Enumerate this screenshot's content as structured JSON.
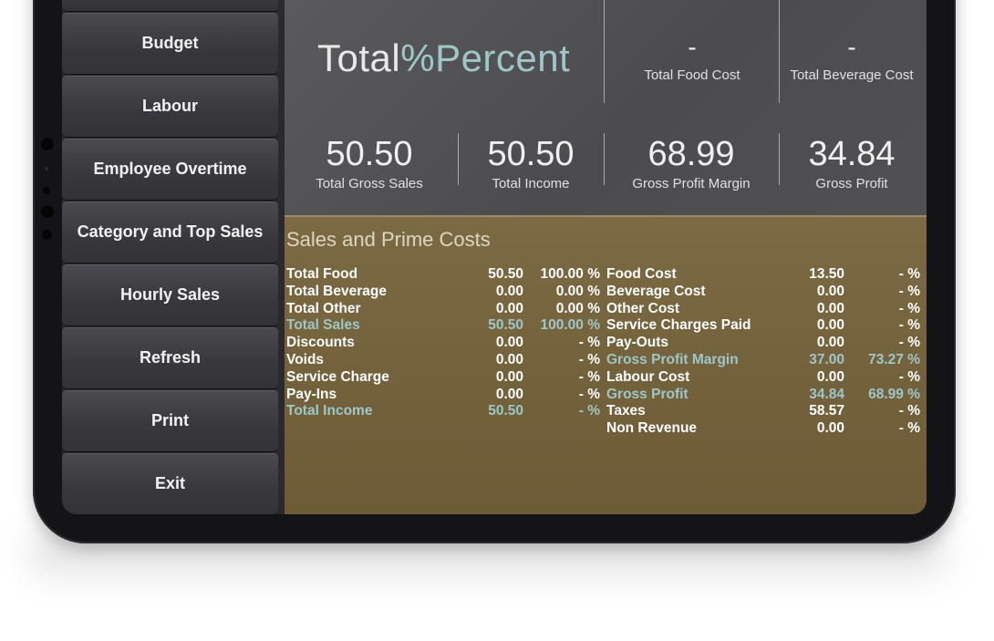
{
  "sidebar": {
    "items": [
      {
        "label": ""
      },
      {
        "label": "Budget"
      },
      {
        "label": "Labour"
      },
      {
        "label": "Employee Overtime"
      },
      {
        "label": "Category and Top Sales"
      },
      {
        "label": "Hourly Sales"
      },
      {
        "label": "Refresh"
      },
      {
        "label": "Print"
      },
      {
        "label": "Exit"
      }
    ]
  },
  "header": {
    "brand_main": "Total",
    "brand_pct": "%Percent"
  },
  "kpis_top": [
    {
      "value": "-",
      "label": "Total Food Cost"
    },
    {
      "value": "-",
      "label": "Total Beverage Cost"
    }
  ],
  "kpis": [
    {
      "value": "50.50",
      "label": "Total Gross Sales"
    },
    {
      "value": "50.50",
      "label": "Total Income"
    },
    {
      "value": "68.99",
      "label": "Gross Profit Margin"
    },
    {
      "value": "34.84",
      "label": "Gross Profit"
    }
  ],
  "panel": {
    "title": "Sales and Prime Costs",
    "left_rows": [
      {
        "label": "Total Food",
        "value": "50.50",
        "pct": "100.00 %",
        "highlight": false
      },
      {
        "label": "Total Beverage",
        "value": "0.00",
        "pct": "0.00 %",
        "highlight": false
      },
      {
        "label": "Total Other",
        "value": "0.00",
        "pct": "0.00 %",
        "highlight": false
      },
      {
        "label": "Total Sales",
        "value": "50.50",
        "pct": "100.00 %",
        "highlight": true
      },
      {
        "label": "Discounts",
        "value": "0.00",
        "pct": "- %",
        "highlight": false
      },
      {
        "label": "Voids",
        "value": "0.00",
        "pct": "- %",
        "highlight": false
      },
      {
        "label": "Service Charge",
        "value": "0.00",
        "pct": "- %",
        "highlight": false
      },
      {
        "label": "Pay-Ins",
        "value": "0.00",
        "pct": "- %",
        "highlight": false
      },
      {
        "label": "Total Income",
        "value": "50.50",
        "pct": "- %",
        "highlight": true
      }
    ],
    "right_rows": [
      {
        "label": "Food Cost",
        "value": "13.50",
        "pct": "- %",
        "highlight": false
      },
      {
        "label": "Beverage Cost",
        "value": "0.00",
        "pct": "- %",
        "highlight": false
      },
      {
        "label": "Other Cost",
        "value": "0.00",
        "pct": "- %",
        "highlight": false
      },
      {
        "label": "Service Charges Paid",
        "value": "0.00",
        "pct": "- %",
        "highlight": false
      },
      {
        "label": "Pay-Outs",
        "value": "0.00",
        "pct": "- %",
        "highlight": false
      },
      {
        "label": "Gross Profit Margin",
        "value": "37.00",
        "pct": "73.27 %",
        "highlight": true
      },
      {
        "label": "Labour Cost",
        "value": "0.00",
        "pct": "- %",
        "highlight": false
      },
      {
        "label": "Gross Profit",
        "value": "34.84",
        "pct": "68.99 %",
        "highlight": true
      },
      {
        "label": "Taxes",
        "value": "58.57",
        "pct": "- %",
        "highlight": false
      },
      {
        "label": "Non Revenue",
        "value": "0.00",
        "pct": "- %",
        "highlight": false
      }
    ]
  },
  "colors": {
    "highlight": "#9ec7c8",
    "panel": "#7b6a43",
    "button": "#3c3c40"
  }
}
